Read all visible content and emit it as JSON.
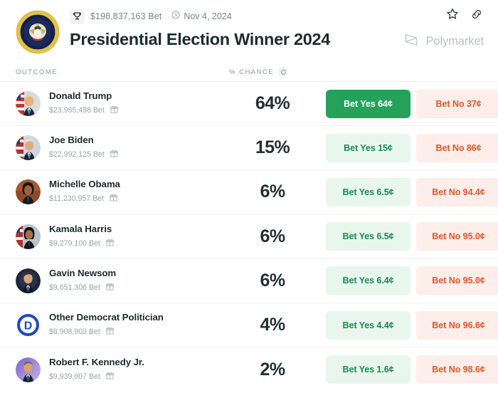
{
  "header": {
    "volume": "$198,837,163 Bet",
    "date": "Nov 4, 2024",
    "title": "Presidential Election Winner 2024",
    "brand": "Polymarket",
    "icons": {
      "trophy": "trophy-icon",
      "clock": "clock-icon",
      "star": "star-icon",
      "link": "link-icon",
      "seal": "presidential-seal-icon",
      "brand_logo": "polymarket-logo-icon"
    }
  },
  "table": {
    "col_outcome": "OUTCOME",
    "col_chance": "% CHANCE",
    "refresh_icon": "refresh-icon"
  },
  "colors": {
    "yes_active_bg": "#25a25a",
    "yes_bg": "#e8f6ee",
    "yes_text": "#1c8a4e",
    "no_bg": "#fdeeea",
    "no_text": "#e0562c",
    "brand_gray": "#b9c0c2"
  },
  "rows": [
    {
      "name": "Donald Trump",
      "volume": "$23,985,498 Bet",
      "chance": "64%",
      "yes_label": "Bet Yes 64¢",
      "no_label": "Bet No 37¢",
      "yes_active": true,
      "avatar": "donald-trump-avatar"
    },
    {
      "name": "Joe Biden",
      "volume": "$22,992,125 Bet",
      "chance": "15%",
      "yes_label": "Bet Yes 15¢",
      "no_label": "Bet No 86¢",
      "yes_active": false,
      "avatar": "joe-biden-avatar"
    },
    {
      "name": "Michelle Obama",
      "volume": "$11,230,957 Bet",
      "chance": "6%",
      "yes_label": "Bet Yes 6.5¢",
      "no_label": "Bet No 94.4¢",
      "yes_active": false,
      "avatar": "michelle-obama-avatar"
    },
    {
      "name": "Kamala Harris",
      "volume": "$9,279,100 Bet",
      "chance": "6%",
      "yes_label": "Bet Yes 6.5¢",
      "no_label": "Bet No 95.0¢",
      "yes_active": false,
      "avatar": "kamala-harris-avatar"
    },
    {
      "name": "Gavin Newsom",
      "volume": "$9,651,306 Bet",
      "chance": "6%",
      "yes_label": "Bet Yes 6.4¢",
      "no_label": "Bet No 95.0¢",
      "yes_active": false,
      "avatar": "gavin-newsom-avatar"
    },
    {
      "name": "Other Democrat Politician",
      "volume": "$8,908,903 Bet",
      "chance": "4%",
      "yes_label": "Bet Yes 4.4¢",
      "no_label": "Bet No 96.6¢",
      "yes_active": false,
      "avatar": "democratic-party-logo-avatar"
    },
    {
      "name": "Robert F. Kennedy Jr.",
      "volume": "$9,939,007 Bet",
      "chance": "2%",
      "yes_label": "Bet Yes 1.6¢",
      "no_label": "Bet No 98.6¢",
      "yes_active": false,
      "avatar": "robert-f-kennedy-jr-avatar"
    }
  ]
}
